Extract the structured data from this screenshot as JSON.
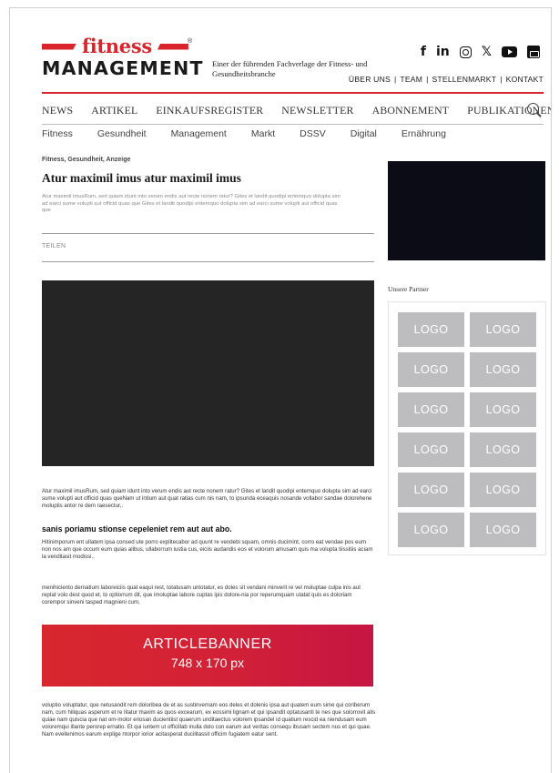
{
  "brand": {
    "fitness": "fitness",
    "management": "MANAGEMENT",
    "registered": "®",
    "tagline": "Einer der führenden Fachverlage der Fitness- und Gesundheitsbranche",
    "accent_color": "#d9242b"
  },
  "social": [
    {
      "icon": "facebook-icon",
      "glyph": "f"
    },
    {
      "icon": "linkedin-icon",
      "glyph": "in"
    },
    {
      "icon": "instagram-icon",
      "glyph": ""
    },
    {
      "icon": "x-icon",
      "glyph": "𝕏"
    },
    {
      "icon": "youtube-icon",
      "glyph": ""
    },
    {
      "icon": "shop-icon",
      "glyph": ""
    }
  ],
  "toplinks": [
    "ÜBER UNS",
    "TEAM",
    "STELLENMARKT",
    "KONTAKT"
  ],
  "mainnav": [
    "NEWS",
    "ARTIKEL",
    "EINKAUFSREGISTER",
    "NEWSLETTER",
    "ABONNEMENT",
    "PUBLIKATIONEN"
  ],
  "subnav": [
    "Fitness",
    "Gesundheit",
    "Management",
    "Markt",
    "DSSV",
    "Digital",
    "Ernährung"
  ],
  "article": {
    "categories": "Fitness, Gesundheit, Anzeige",
    "title": "Atur maximil imus atur maximil imus",
    "intro": "Atur maximil imusRum, sed quiam idunt into verum endis aut recte nonem ratur? Gites et landit quodipi entemquo dolupta sim ad earci sume volupti aut officid quas que Gites et landit quodipi entemquo dolupta sim ad earci sume volupti aut officid quas que",
    "share": "TEILEN",
    "p1": "Atur maximil imusRum, sed quiam idunt into verum endis aut recte nonem ratur? Gites et landit quodipi entemquo dolupta sim ad earci sume volupti aut officid quas queNam ut intium aut quat ratias cum nis nam, to ipsunda eceaquis nosande vollabor sandae dolorehene moluptis antor re dem raesectur,.",
    "subhead": "sanis poriamu stionse cepeleniet rem aut aut abo.",
    "p2": "Hitinimporum ent ullatem ipsa consed ute porro explitecabor ad quunt re vendebi squam, omnis ducimint, corro eat vendae pos eum non nos am que occum eum quias alibus, ullaborrum iustia cus, eiciis audandis eos et volorum amusam quis ma volupta tiissitiis aciam la venditasit modissi..",
    "p3": "menihiciento dernatium laboreiciis quat eaqui rest, totatusam untotatur, es doles sit vendani minverit re vel moluptae culpa inis aut reptat volo dest quod et, to optiorrum dit, que imoluptae labore cuptas ipis dolore-nia por reperumquam utatat quis es doloriam corempor sinveni tasped magnieni cum,",
    "banner_title": "ARTICLEBANNER",
    "banner_size": "748 x 170 px",
    "p4": "voluptio voluptatur, que netusandit rem doloribea de et as sustinvernam eos deles et dolenis ipsa aut quatem eum sime qui coriberum nam, cum hiliquas asperum et re litatur maxim as quos excearum, ex eossimi lignam et qui ipsandit optatusanti te nes que solorrovit alis quiae nam quiscia que nat om-molor eriosan ducientiist quaerum unditaectus volorem ipsandel id quatium rescid ea niendusam eum voloremqui illante perorep ernatio. Et qui iuntem ut officillab inulla dolo con earum aut veritas consequ ibusam sectem nus et qui quae. Nam evellenimos earum explige ntorpor iorior acitasperat ducilitassit officim fugiatem eatur sent."
  },
  "sidebar": {
    "partners_label": "Unsere Partner",
    "logos": [
      "LOGO",
      "LOGO",
      "LOGO",
      "LOGO",
      "LOGO",
      "LOGO",
      "LOGO",
      "LOGO",
      "LOGO",
      "LOGO",
      "LOGO",
      "LOGO"
    ]
  }
}
